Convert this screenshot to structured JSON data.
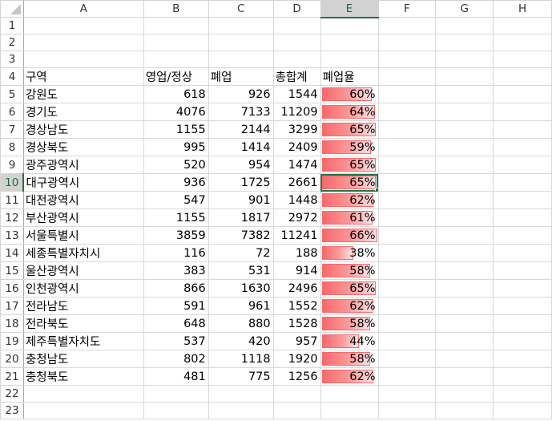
{
  "column_headers": [
    "A",
    "B",
    "C",
    "D",
    "E",
    "F",
    "G",
    "H"
  ],
  "selection": {
    "cell": "E10",
    "column": "E",
    "row": 10
  },
  "data_bar": {
    "color": "#f8696b",
    "max": 0.66
  },
  "header_row": {
    "row": 4,
    "cells": [
      "구역",
      "영업/정상",
      "폐업",
      "총합계",
      "폐업율"
    ]
  },
  "table_rows": [
    {
      "row": 5,
      "region": "강원도",
      "open": "618",
      "closed": "926",
      "total": "1544",
      "rate_text": "60%",
      "rate": 0.6
    },
    {
      "row": 6,
      "region": "경기도",
      "open": "4076",
      "closed": "7133",
      "total": "11209",
      "rate_text": "64%",
      "rate": 0.64
    },
    {
      "row": 7,
      "region": "경상남도",
      "open": "1155",
      "closed": "2144",
      "total": "3299",
      "rate_text": "65%",
      "rate": 0.65
    },
    {
      "row": 8,
      "region": "경상북도",
      "open": "995",
      "closed": "1414",
      "total": "2409",
      "rate_text": "59%",
      "rate": 0.59
    },
    {
      "row": 9,
      "region": "광주광역시",
      "open": "520",
      "closed": "954",
      "total": "1474",
      "rate_text": "65%",
      "rate": 0.65
    },
    {
      "row": 10,
      "region": "대구광역시",
      "open": "936",
      "closed": "1725",
      "total": "2661",
      "rate_text": "65%",
      "rate": 0.65
    },
    {
      "row": 11,
      "region": "대전광역시",
      "open": "547",
      "closed": "901",
      "total": "1448",
      "rate_text": "62%",
      "rate": 0.62
    },
    {
      "row": 12,
      "region": "부산광역시",
      "open": "1155",
      "closed": "1817",
      "total": "2972",
      "rate_text": "61%",
      "rate": 0.61
    },
    {
      "row": 13,
      "region": "서울특별시",
      "open": "3859",
      "closed": "7382",
      "total": "11241",
      "rate_text": "66%",
      "rate": 0.66
    },
    {
      "row": 14,
      "region": "세종특별자치시",
      "open": "116",
      "closed": "72",
      "total": "188",
      "rate_text": "38%",
      "rate": 0.38
    },
    {
      "row": 15,
      "region": "울산광역시",
      "open": "383",
      "closed": "531",
      "total": "914",
      "rate_text": "58%",
      "rate": 0.58
    },
    {
      "row": 16,
      "region": "인천광역시",
      "open": "866",
      "closed": "1630",
      "total": "2496",
      "rate_text": "65%",
      "rate": 0.65
    },
    {
      "row": 17,
      "region": "전라남도",
      "open": "591",
      "closed": "961",
      "total": "1552",
      "rate_text": "62%",
      "rate": 0.62
    },
    {
      "row": 18,
      "region": "전라북도",
      "open": "648",
      "closed": "880",
      "total": "1528",
      "rate_text": "58%",
      "rate": 0.58
    },
    {
      "row": 19,
      "region": "제주특별자치도",
      "open": "537",
      "closed": "420",
      "total": "957",
      "rate_text": "44%",
      "rate": 0.44
    },
    {
      "row": 20,
      "region": "충청남도",
      "open": "802",
      "closed": "1118",
      "total": "1920",
      "rate_text": "58%",
      "rate": 0.58
    },
    {
      "row": 21,
      "region": "충청북도",
      "open": "481",
      "closed": "775",
      "total": "1256",
      "rate_text": "62%",
      "rate": 0.62
    }
  ],
  "empty_rows_before": [
    1,
    2,
    3
  ],
  "empty_rows_after": [
    22,
    23
  ]
}
